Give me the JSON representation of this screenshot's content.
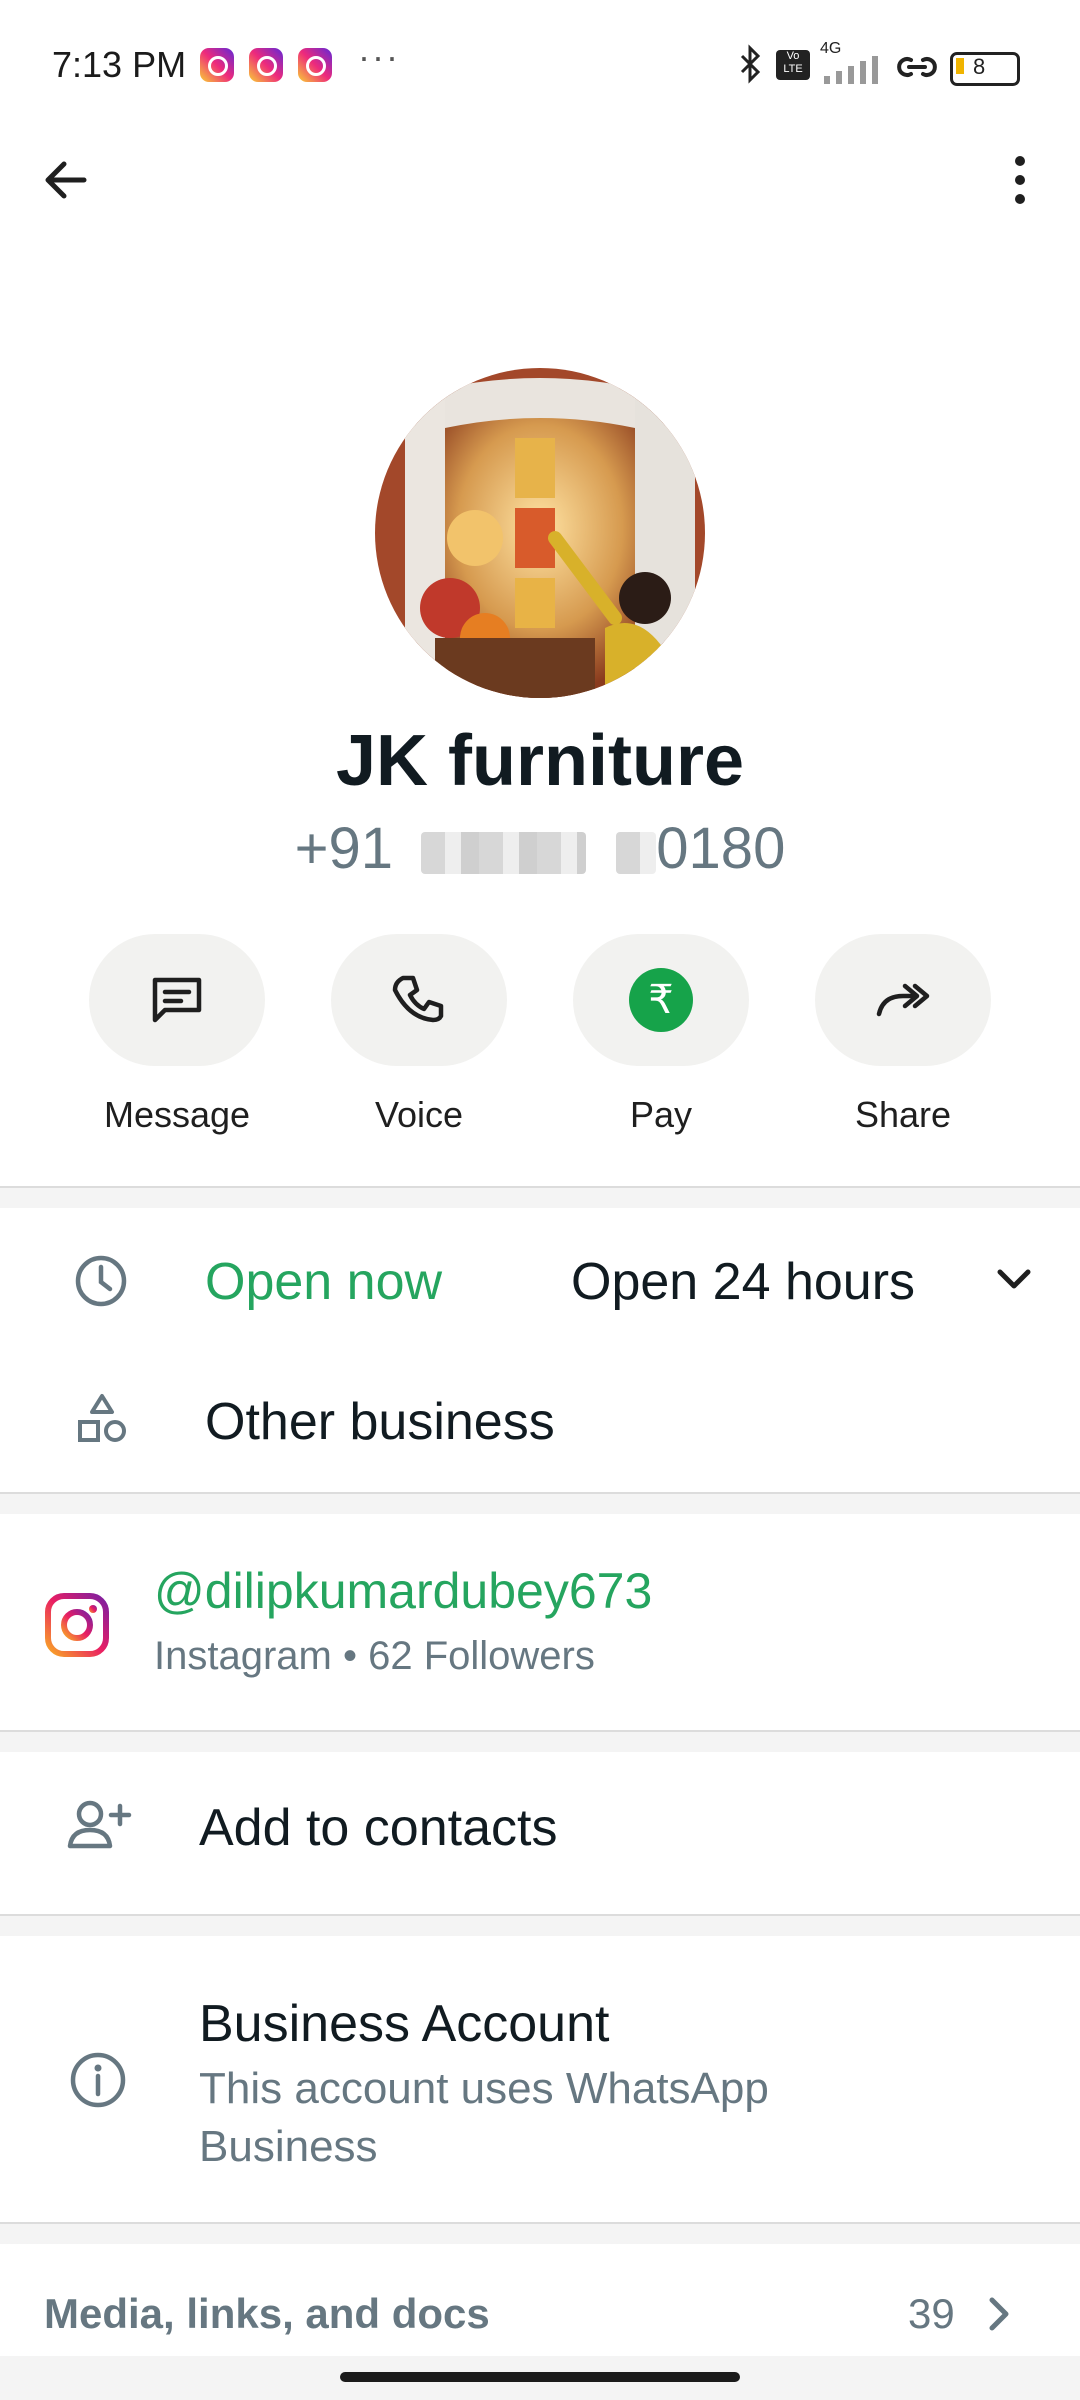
{
  "status_bar": {
    "time": "7:13 PM",
    "more": "···",
    "battery": "8",
    "network": "4G"
  },
  "profile": {
    "name": "JK furniture",
    "phone_prefix": "+91",
    "phone_suffix": "0180"
  },
  "actions": [
    {
      "label": "Message",
      "icon": "message-icon"
    },
    {
      "label": "Voice",
      "icon": "phone-icon"
    },
    {
      "label": "Pay",
      "icon": "rupee-icon"
    },
    {
      "label": "Share",
      "icon": "share-icon"
    }
  ],
  "business": {
    "status": "Open now",
    "hours": "Open 24 hours",
    "category": "Other business"
  },
  "instagram": {
    "handle": "@dilipkumardubey673",
    "details": "Instagram • 62 Followers"
  },
  "add_contact": {
    "label": "Add to contacts"
  },
  "business_account": {
    "title": "Business Account",
    "description_line1": "This account uses WhatsApp",
    "description_line2": "Business"
  },
  "media": {
    "label": "Media, links, and docs",
    "count": "39"
  },
  "colors": {
    "accent_green": "#25a55f",
    "pay_green": "#16a34a",
    "secondary_text": "#667781"
  }
}
